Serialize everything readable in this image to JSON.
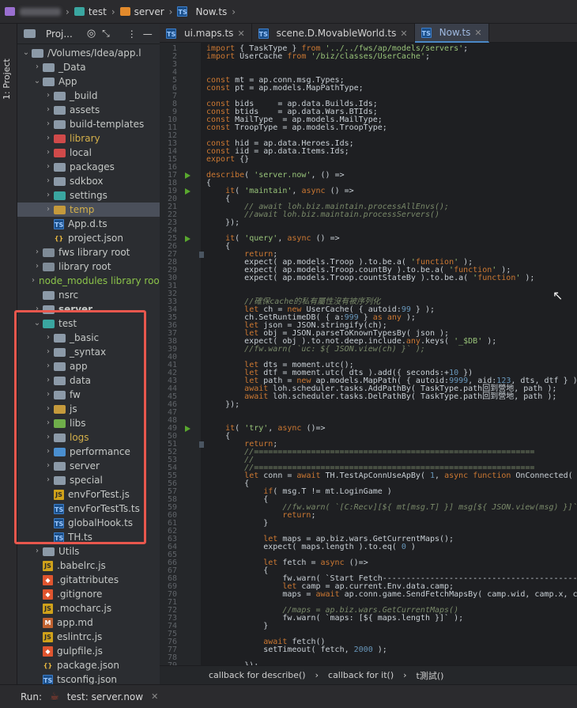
{
  "breadcrumb": {
    "items": [
      "test",
      "server",
      "Now.ts"
    ]
  },
  "sidebar_tab": "1: Project",
  "project_header": {
    "label": "Proj...",
    "icons": [
      "target-icon",
      "collapse-icon",
      "more-icon",
      "minimize-icon"
    ]
  },
  "tree": [
    {
      "label": "/Volumes/Idea/app.l",
      "indent": 0,
      "kind": "root"
    },
    {
      "label": "_Data",
      "indent": 1,
      "kind": "folder"
    },
    {
      "label": "App",
      "indent": 1,
      "kind": "folder",
      "open": true
    },
    {
      "label": "_build",
      "indent": 2,
      "kind": "folder"
    },
    {
      "label": "assets",
      "indent": 2,
      "kind": "folder"
    },
    {
      "label": "build-templates",
      "indent": 2,
      "kind": "folder"
    },
    {
      "label": "library",
      "indent": 2,
      "kind": "folder",
      "color": "red",
      "text": "amber"
    },
    {
      "label": "local",
      "indent": 2,
      "kind": "folder",
      "color": "red"
    },
    {
      "label": "packages",
      "indent": 2,
      "kind": "folder"
    },
    {
      "label": "sdkbox",
      "indent": 2,
      "kind": "folder"
    },
    {
      "label": "settings",
      "indent": 2,
      "kind": "folder",
      "color": "teal"
    },
    {
      "label": "temp",
      "indent": 2,
      "kind": "folder",
      "color": "yel",
      "text": "amber",
      "selected": true
    },
    {
      "label": "App.d.ts",
      "indent": 2,
      "kind": "ts"
    },
    {
      "label": "project.json",
      "indent": 2,
      "kind": "json"
    },
    {
      "label": "fws  library root",
      "indent": 1,
      "kind": "folder",
      "color": "lib"
    },
    {
      "label": "library root",
      "indent": 1,
      "kind": "folder",
      "color": "lib"
    },
    {
      "label": "node_modules  library root",
      "indent": 1,
      "kind": "folder",
      "color": "green",
      "text": "green"
    },
    {
      "label": "nsrc",
      "indent": 1,
      "kind": "folder",
      "nochev": true
    },
    {
      "label": "server",
      "indent": 1,
      "kind": "folder",
      "bold": true
    },
    {
      "label": "test",
      "indent": 1,
      "kind": "folder",
      "open": true,
      "color": "teal"
    },
    {
      "label": "_basic",
      "indent": 2,
      "kind": "folder"
    },
    {
      "label": "_syntax",
      "indent": 2,
      "kind": "folder"
    },
    {
      "label": "app",
      "indent": 2,
      "kind": "folder"
    },
    {
      "label": "data",
      "indent": 2,
      "kind": "folder"
    },
    {
      "label": "fw",
      "indent": 2,
      "kind": "folder"
    },
    {
      "label": "js",
      "indent": 2,
      "kind": "folder",
      "color": "yel"
    },
    {
      "label": "libs",
      "indent": 2,
      "kind": "folder",
      "color": "green"
    },
    {
      "label": "logs",
      "indent": 2,
      "kind": "folder",
      "text": "amber"
    },
    {
      "label": "performance",
      "indent": 2,
      "kind": "folder",
      "color": "blue"
    },
    {
      "label": "server",
      "indent": 2,
      "kind": "folder"
    },
    {
      "label": "special",
      "indent": 2,
      "kind": "folder"
    },
    {
      "label": "envForTest.js",
      "indent": 2,
      "kind": "js"
    },
    {
      "label": "envForTestTs.ts",
      "indent": 2,
      "kind": "ts"
    },
    {
      "label": "globalHook.ts",
      "indent": 2,
      "kind": "ts"
    },
    {
      "label": "TH.ts",
      "indent": 2,
      "kind": "ts"
    },
    {
      "label": "Utils",
      "indent": 1,
      "kind": "folder"
    },
    {
      "label": ".babelrc.js",
      "indent": 1,
      "kind": "js"
    },
    {
      "label": ".gitattributes",
      "indent": 1,
      "kind": "git"
    },
    {
      "label": ".gitignore",
      "indent": 1,
      "kind": "git"
    },
    {
      "label": ".mocharc.js",
      "indent": 1,
      "kind": "js"
    },
    {
      "label": "app.md",
      "indent": 1,
      "kind": "md"
    },
    {
      "label": "eslintrc.js",
      "indent": 1,
      "kind": "js"
    },
    {
      "label": "gulpfile.js",
      "indent": 1,
      "kind": "git"
    },
    {
      "label": "package.json",
      "indent": 1,
      "kind": "json"
    },
    {
      "label": "tsconfig.json",
      "indent": 1,
      "kind": "ts"
    }
  ],
  "tabs": [
    {
      "label": "ui.maps.ts",
      "active": false
    },
    {
      "label": "scene.D.MovableWorld.ts",
      "active": false
    },
    {
      "label": "Now.ts",
      "active": true
    }
  ],
  "code_lines": [
    [
      "1",
      "import { TaskType } from '../../fws/ap/models/servers';"
    ],
    [
      "2",
      "import UserCache from '/biz/classes/UserCache';"
    ],
    [
      "3",
      ""
    ],
    [
      "4",
      ""
    ],
    [
      "5",
      "const mt = ap.conn.msg.Types;"
    ],
    [
      "6",
      "const pt = ap.models.MapPathType;"
    ],
    [
      "7",
      ""
    ],
    [
      "8",
      "const bids     = ap.data.Builds.Ids;"
    ],
    [
      "9",
      "const btids    = ap.data.Wars.BTIds;"
    ],
    [
      "10",
      "const MailType  = ap.models.MailType;"
    ],
    [
      "11",
      "const TroopType = ap.models.TroopType;"
    ],
    [
      "12",
      ""
    ],
    [
      "13",
      "const hid = ap.data.Heroes.Ids;"
    ],
    [
      "14",
      "const iid = ap.data.Items.Ids;"
    ],
    [
      "15",
      "export {}"
    ],
    [
      "16",
      ""
    ],
    [
      "17",
      "describe( 'server.now', () =>"
    ],
    [
      "18",
      "{"
    ],
    [
      "19",
      "    it( 'maintain', async () =>"
    ],
    [
      "20",
      "    {"
    ],
    [
      "21",
      "        // await loh.biz.maintain.processAllEnvs();"
    ],
    [
      "22",
      "        //await loh.biz.maintain.processServers()"
    ],
    [
      "23",
      "    });"
    ],
    [
      "24",
      ""
    ],
    [
      "25",
      "    it( 'query', async () =>"
    ],
    [
      "26",
      "    {"
    ],
    [
      "27",
      "        return;"
    ],
    [
      "28",
      "        expect( ap.models.Troop ).to.be.a( 'function' );"
    ],
    [
      "29",
      "        expect( ap.models.Troop.countBy ).to.be.a( 'function' );"
    ],
    [
      "30",
      "        expect( ap.models.Troop.countStateBy ).to.be.a( 'function' );"
    ],
    [
      "31",
      ""
    ],
    [
      "32",
      ""
    ],
    [
      "33",
      "        //確保cache的私有屬性沒有被序列化"
    ],
    [
      "34",
      "        let ch = new UserCache( { autoid:99 } );"
    ],
    [
      "35",
      "        ch.SetRuntimeDB( { a:999 } as any );"
    ],
    [
      "36",
      "        let json = JSON.stringify(ch);"
    ],
    [
      "37",
      "        let obj = JSON.parseToKnownTypesBy( json );"
    ],
    [
      "38",
      "        expect( obj ).to.not.deep.include.any.keys( '_$DB' );"
    ],
    [
      "39",
      "        //fw.warn( `uc: ${ JSON.view(ch) }` );"
    ],
    [
      "40",
      ""
    ],
    [
      "41",
      "        let dts = moment.utc();"
    ],
    [
      "42",
      "        let dtf = moment.utc( dts ).add({ seconds:+10 })"
    ],
    [
      "43",
      "        let path = new ap.models.MapPath( { autoid:9999, aid:123, dts, dtf } )"
    ],
    [
      "44",
      "        await loh.scheduler.tasks.AddPathBy( TaskType.path回到營地, path );"
    ],
    [
      "45",
      "        await loh.scheduler.tasks.DelPathBy( TaskType.path回到營地, path );"
    ],
    [
      "46",
      "    });"
    ],
    [
      "47",
      ""
    ],
    [
      "48",
      ""
    ],
    [
      "49",
      "    it( 'try', async ()=>"
    ],
    [
      "50",
      "    {"
    ],
    [
      "51",
      "        return;"
    ],
    [
      "52",
      "        //==========================================================="
    ],
    [
      "53",
      "        //"
    ],
    [
      "54",
      "        //==========================================================="
    ],
    [
      "55",
      "        let conn = await TH.TestApConnUseApBy( 1, async function OnConnected( c"
    ],
    [
      "56",
      "        {"
    ],
    [
      "57",
      "            if( msg.T != mt.LoginGame )"
    ],
    [
      "58",
      "            {"
    ],
    [
      "59",
      "                //fw.warn( `[C:Recv][${ mt[msg.T] }] msg[${ JSON.view(msg) }]`"
    ],
    [
      "60",
      "                return;"
    ],
    [
      "61",
      "            }"
    ],
    [
      "62",
      ""
    ],
    [
      "63",
      "            let maps = ap.biz.wars.GetCurrentMaps();"
    ],
    [
      "64",
      "            expect( maps.length ).to.eq( 0 )"
    ],
    [
      "65",
      ""
    ],
    [
      "66",
      "            let fetch = async ()=>"
    ],
    [
      "67",
      "            {"
    ],
    [
      "68",
      "                fw.warn( `Start Fetch--------------------------------------------"
    ],
    [
      "69",
      "                let camp = ap.current.Env.data.camp;"
    ],
    [
      "70",
      "                maps = await ap.conn.game.SendFetchMapsBy( camp.wid, camp.x, ca"
    ],
    [
      "71",
      ""
    ],
    [
      "72",
      "                //maps = ap.biz.wars.GetCurrentMaps()"
    ],
    [
      "73",
      "                fw.warn( `maps: [${ maps.length }]` );"
    ],
    [
      "74",
      "            }"
    ],
    [
      "75",
      ""
    ],
    [
      "76",
      "            await fetch()"
    ],
    [
      "77",
      "            setTimeout( fetch, 2000 );"
    ],
    [
      "78",
      ""
    ],
    [
      "79",
      "        });"
    ]
  ],
  "run_markers": [
    "17",
    "19",
    "25",
    "49"
  ],
  "status": {
    "items": [
      "callback for describe()",
      "callback for it()",
      "t測試()"
    ]
  },
  "run": {
    "label": "Run:",
    "config": "test: server.now"
  },
  "colors": {
    "highlight": "#e8574d",
    "accent": "#4a88c7",
    "keyword": "#cc7832"
  }
}
